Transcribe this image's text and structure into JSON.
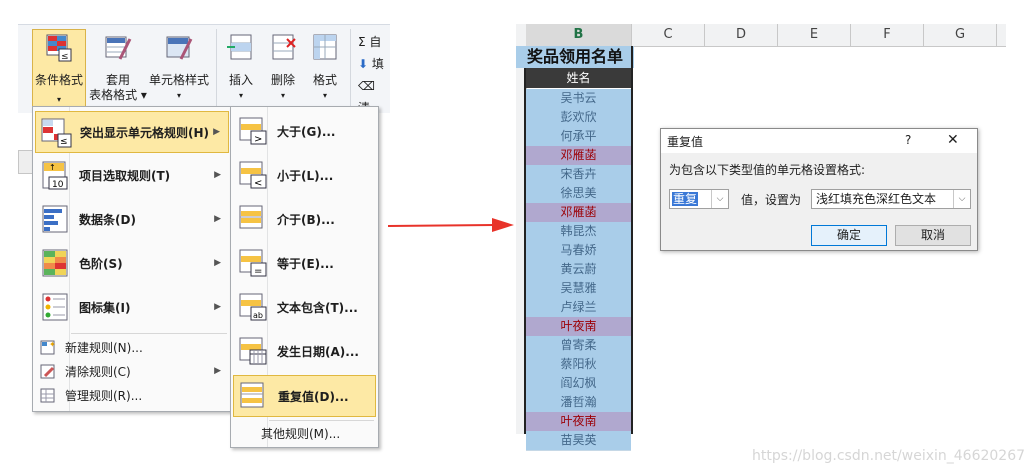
{
  "ribbon": {
    "conditional_format": "条件格式",
    "format_as_table_1": "套用",
    "format_as_table_2": "表格格式",
    "cell_styles": "单元格样式",
    "insert": "插入",
    "delete": "删除",
    "format": "格式",
    "autosum_partial": "自",
    "fill_partial": "填",
    "clear_partial": "清"
  },
  "main_menu": {
    "items": [
      {
        "label": "突出显示单元格规则(H)",
        "highlighted": true
      },
      {
        "label": "项目选取规则(T)"
      },
      {
        "label": "数据条(D)"
      },
      {
        "label": "色阶(S)"
      },
      {
        "label": "图标集(I)"
      }
    ],
    "small_items": [
      {
        "label": "新建规则(N)..."
      },
      {
        "label": "清除规则(C)"
      },
      {
        "label": "管理规则(R)..."
      }
    ]
  },
  "sub_menu": {
    "items": [
      {
        "label": "大于(G)..."
      },
      {
        "label": "小于(L)..."
      },
      {
        "label": "介于(B)..."
      },
      {
        "label": "等于(E)..."
      },
      {
        "label": "文本包含(T)..."
      },
      {
        "label": "发生日期(A)..."
      },
      {
        "label": "重复值(D)...",
        "highlighted": true
      }
    ],
    "other": "其他规则(M)..."
  },
  "sheet": {
    "columns": [
      "B",
      "C",
      "D",
      "E",
      "F",
      "G"
    ],
    "title": "奖品领用名单",
    "header": "姓名",
    "names": [
      {
        "v": "吴书云"
      },
      {
        "v": "彭欢欣"
      },
      {
        "v": "何承平"
      },
      {
        "v": "邓雁菡",
        "dup": true
      },
      {
        "v": "宋香卉"
      },
      {
        "v": "徐思美"
      },
      {
        "v": "邓雁菡",
        "dup": true
      },
      {
        "v": "韩昆杰"
      },
      {
        "v": "马春娇"
      },
      {
        "v": "黄云蔚"
      },
      {
        "v": "吴慧雅"
      },
      {
        "v": "卢绿兰"
      },
      {
        "v": "叶夜南",
        "dup": true
      },
      {
        "v": "曾寄柔"
      },
      {
        "v": "蔡阳秋"
      },
      {
        "v": "阎幻枫"
      },
      {
        "v": "潘哲瀚"
      },
      {
        "v": "叶夜南",
        "dup": true
      },
      {
        "v": "苗昊英"
      }
    ]
  },
  "dialog": {
    "title": "重复值",
    "help": "?",
    "close": "✕",
    "instruction": "为包含以下类型值的单元格设置格式:",
    "type_value": "重复",
    "mid_label": "值，设置为",
    "format_value": "浅红填充色深红色文本",
    "ok": "确定",
    "cancel": "取消"
  },
  "watermark": "https://blog.csdn.net/weixin_46620267",
  "colors": {
    "accent": "#fde9a5",
    "duplicate_fill": "#ffc7ce",
    "duplicate_text": "#9c0006",
    "arrow": "#e8332a"
  }
}
